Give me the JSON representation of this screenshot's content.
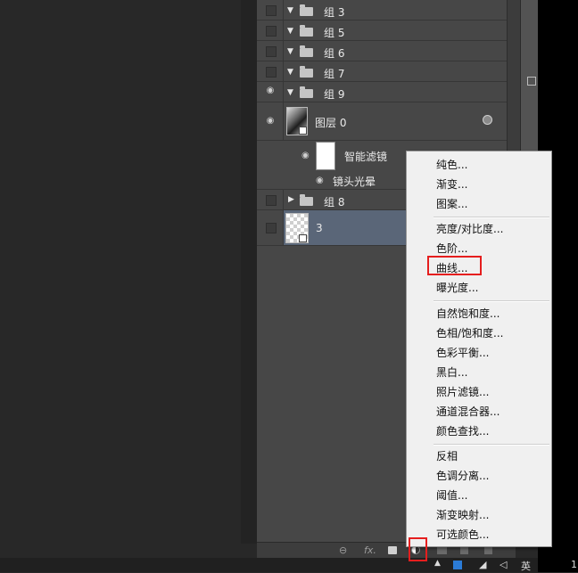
{
  "layers_panel": {
    "rows": [
      {
        "name": "组 3",
        "type": "group"
      },
      {
        "name": "组 5",
        "type": "group"
      },
      {
        "name": "组 6",
        "type": "group"
      },
      {
        "name": "组 7",
        "type": "group"
      },
      {
        "name": "组 9",
        "type": "group"
      },
      {
        "name": "图层 0",
        "type": "smart-object"
      },
      {
        "name": "智能滤镜",
        "type": "smart-filter"
      },
      {
        "name": "镜头光晕",
        "type": "filter"
      },
      {
        "name": "组 8",
        "type": "group"
      },
      {
        "name": "3",
        "type": "layer"
      }
    ]
  },
  "bottom_bar": {
    "fx_label": "fx."
  },
  "adjustment_menu": {
    "items": [
      "纯色...",
      "渐变...",
      "图案...",
      "亮度/对比度...",
      "色阶...",
      "曲线...",
      "曝光度...",
      "自然饱和度...",
      "色相/饱和度...",
      "色彩平衡...",
      "黑白...",
      "照片滤镜...",
      "通道混合器...",
      "颜色查找...",
      "反相",
      "色调分离...",
      "阈值...",
      "渐变映射...",
      "可选颜色..."
    ],
    "highlighted_item": "曲线..."
  },
  "taskbar": {
    "ime_label": "英",
    "clock_partial": "1"
  },
  "colors": {
    "panel_bg": "#474747",
    "selected_row": "#5a6678",
    "menu_bg": "#f0f0f0",
    "highlight_red": "#e51e1e"
  }
}
